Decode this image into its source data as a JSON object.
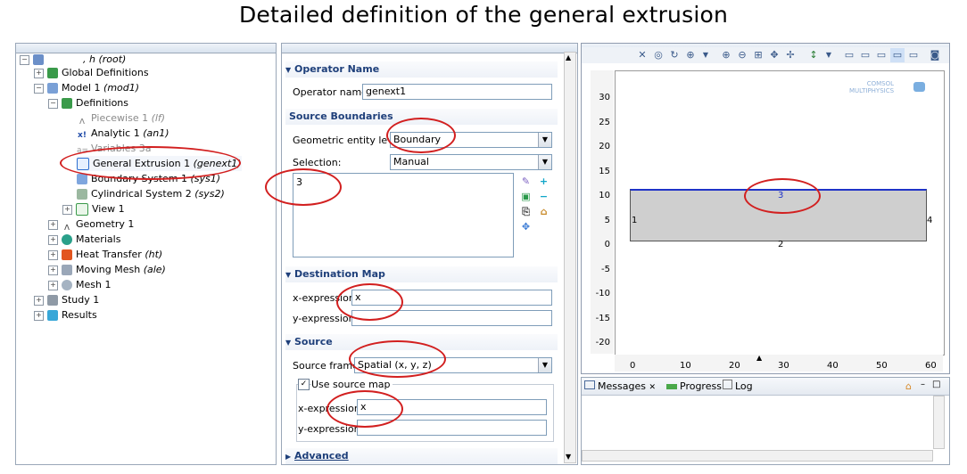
{
  "title": "Detailed definition of the general extrusion",
  "tree": {
    "root": ", h (root)",
    "items": [
      {
        "label": "Global Definitions",
        "tag": ""
      },
      {
        "label": "Model 1",
        "tag": "(mod1)"
      },
      {
        "label": "Definitions",
        "tag": ""
      },
      {
        "label": "Piecewise 1",
        "tag": "(lf)"
      },
      {
        "label": "Analytic 1",
        "tag": "(an1)"
      },
      {
        "label": "Variables 3a",
        "tag": ""
      },
      {
        "label": "General Extrusion 1",
        "tag": "(genext1)"
      },
      {
        "label": "Boundary System 1",
        "tag": "(sys1)"
      },
      {
        "label": "Cylindrical System 2",
        "tag": "(sys2)"
      },
      {
        "label": "View 1",
        "tag": ""
      },
      {
        "label": "Geometry 1",
        "tag": ""
      },
      {
        "label": "Materials",
        "tag": ""
      },
      {
        "label": "Heat Transfer",
        "tag": "(ht)"
      },
      {
        "label": "Moving Mesh",
        "tag": "(ale)"
      },
      {
        "label": "Mesh 1",
        "tag": ""
      },
      {
        "label": "Study 1",
        "tag": ""
      },
      {
        "label": "Results",
        "tag": ""
      }
    ]
  },
  "settings": {
    "operator_name": {
      "header": "Operator Name",
      "label": "Operator name:",
      "value": "genext1"
    },
    "source_boundaries": {
      "header": "Source Boundaries",
      "entity_label": "Geometric entity level:",
      "entity_value": "Boundary",
      "selection_label": "Selection:",
      "selection_value": "Manual",
      "list_value": "3"
    },
    "destination_map": {
      "header": "Destination Map",
      "x_label": "x-expression:",
      "x_value": "x",
      "y_label": "y-expression:",
      "y_value": ""
    },
    "source": {
      "header": "Source",
      "frame_label": "Source frame:",
      "frame_value": "Spatial  (x, y, z)",
      "use_map_label": "Use source map",
      "x_label": "x-expression:",
      "x_value": "x",
      "y_label": "y-expression:",
      "y_value": ""
    },
    "advanced": {
      "header": "Advanced"
    }
  },
  "graphics": {
    "logo_line1": "COMSOL",
    "logo_line2": "MULTIPHYSICS",
    "y_ticks": [
      "30",
      "25",
      "20",
      "15",
      "10",
      "5",
      "0",
      "-5",
      "-10",
      "-15",
      "-20"
    ],
    "x_ticks": [
      "0",
      "10",
      "20",
      "30",
      "40",
      "50",
      "60"
    ],
    "boundary_labels": {
      "b1": "1",
      "b2": "2",
      "b3": "3",
      "b4": "4"
    }
  },
  "messages": {
    "tabs": [
      "Messages",
      "Progress",
      "Log"
    ]
  },
  "colors": {
    "accent_red": "#d21f1f",
    "selected_boundary": "#1f33c8",
    "domain_fill": "#cfcfcf"
  }
}
